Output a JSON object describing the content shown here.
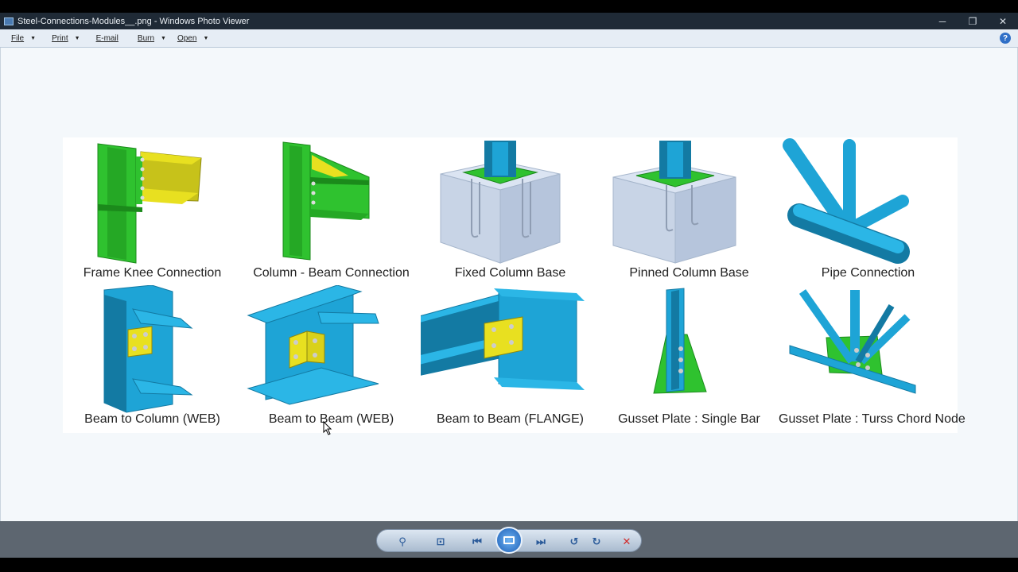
{
  "window": {
    "title": "Steel-Connections-Modules__.png - Windows Photo Viewer",
    "minimize": "─",
    "restore": "❐",
    "close": "✕"
  },
  "menu": {
    "items": [
      {
        "label": "File",
        "has_caret": true
      },
      {
        "label": "Print",
        "has_caret": true
      },
      {
        "label": "E-mail",
        "has_caret": false
      },
      {
        "label": "Burn",
        "has_caret": true
      },
      {
        "label": "Open",
        "has_caret": true
      }
    ],
    "caret": "▼",
    "help": "?"
  },
  "image": {
    "captions": [
      "Frame Knee Connection",
      "Column - Beam Connection",
      "Fixed Column Base",
      "Pinned Column Base",
      "Pipe Connection",
      "Beam to Column (WEB)",
      "Beam to Beam (WEB)",
      "Beam to Beam (FLANGE)",
      "Gusset Plate : Single Bar",
      "Gusset Plate : Turss Chord Node"
    ],
    "colors": {
      "green": "#2fc22f",
      "dark_green": "#1b8a1b",
      "yellow": "#e8e020",
      "blue": "#1ea4d6",
      "dark_blue": "#137aa3",
      "concrete": "#c8d4e6"
    }
  },
  "toolbar": {
    "zoom": "⚲",
    "fit": "⊡",
    "prev": "⏮",
    "next": "⏭",
    "rotate_ccw": "↺",
    "rotate_cw": "↻",
    "delete": "✕"
  }
}
